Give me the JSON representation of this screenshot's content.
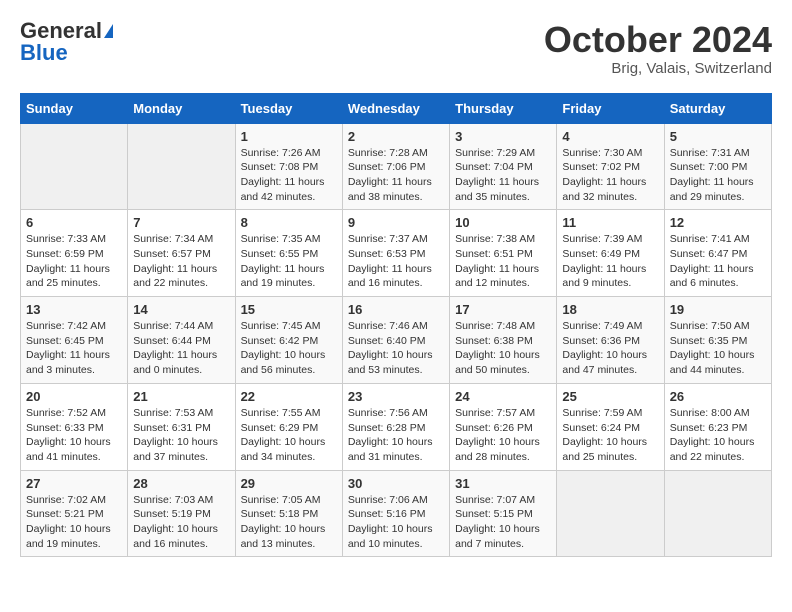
{
  "header": {
    "logo_general": "General",
    "logo_blue": "Blue",
    "month_title": "October 2024",
    "location": "Brig, Valais, Switzerland"
  },
  "days_of_week": [
    "Sunday",
    "Monday",
    "Tuesday",
    "Wednesday",
    "Thursday",
    "Friday",
    "Saturday"
  ],
  "weeks": [
    [
      {
        "num": "",
        "sunrise": "",
        "sunset": "",
        "daylight": "",
        "empty": true
      },
      {
        "num": "",
        "sunrise": "",
        "sunset": "",
        "daylight": "",
        "empty": true
      },
      {
        "num": "1",
        "sunrise": "Sunrise: 7:26 AM",
        "sunset": "Sunset: 7:08 PM",
        "daylight": "Daylight: 11 hours and 42 minutes."
      },
      {
        "num": "2",
        "sunrise": "Sunrise: 7:28 AM",
        "sunset": "Sunset: 7:06 PM",
        "daylight": "Daylight: 11 hours and 38 minutes."
      },
      {
        "num": "3",
        "sunrise": "Sunrise: 7:29 AM",
        "sunset": "Sunset: 7:04 PM",
        "daylight": "Daylight: 11 hours and 35 minutes."
      },
      {
        "num": "4",
        "sunrise": "Sunrise: 7:30 AM",
        "sunset": "Sunset: 7:02 PM",
        "daylight": "Daylight: 11 hours and 32 minutes."
      },
      {
        "num": "5",
        "sunrise": "Sunrise: 7:31 AM",
        "sunset": "Sunset: 7:00 PM",
        "daylight": "Daylight: 11 hours and 29 minutes."
      }
    ],
    [
      {
        "num": "6",
        "sunrise": "Sunrise: 7:33 AM",
        "sunset": "Sunset: 6:59 PM",
        "daylight": "Daylight: 11 hours and 25 minutes."
      },
      {
        "num": "7",
        "sunrise": "Sunrise: 7:34 AM",
        "sunset": "Sunset: 6:57 PM",
        "daylight": "Daylight: 11 hours and 22 minutes."
      },
      {
        "num": "8",
        "sunrise": "Sunrise: 7:35 AM",
        "sunset": "Sunset: 6:55 PM",
        "daylight": "Daylight: 11 hours and 19 minutes."
      },
      {
        "num": "9",
        "sunrise": "Sunrise: 7:37 AM",
        "sunset": "Sunset: 6:53 PM",
        "daylight": "Daylight: 11 hours and 16 minutes."
      },
      {
        "num": "10",
        "sunrise": "Sunrise: 7:38 AM",
        "sunset": "Sunset: 6:51 PM",
        "daylight": "Daylight: 11 hours and 12 minutes."
      },
      {
        "num": "11",
        "sunrise": "Sunrise: 7:39 AM",
        "sunset": "Sunset: 6:49 PM",
        "daylight": "Daylight: 11 hours and 9 minutes."
      },
      {
        "num": "12",
        "sunrise": "Sunrise: 7:41 AM",
        "sunset": "Sunset: 6:47 PM",
        "daylight": "Daylight: 11 hours and 6 minutes."
      }
    ],
    [
      {
        "num": "13",
        "sunrise": "Sunrise: 7:42 AM",
        "sunset": "Sunset: 6:45 PM",
        "daylight": "Daylight: 11 hours and 3 minutes."
      },
      {
        "num": "14",
        "sunrise": "Sunrise: 7:44 AM",
        "sunset": "Sunset: 6:44 PM",
        "daylight": "Daylight: 11 hours and 0 minutes."
      },
      {
        "num": "15",
        "sunrise": "Sunrise: 7:45 AM",
        "sunset": "Sunset: 6:42 PM",
        "daylight": "Daylight: 10 hours and 56 minutes."
      },
      {
        "num": "16",
        "sunrise": "Sunrise: 7:46 AM",
        "sunset": "Sunset: 6:40 PM",
        "daylight": "Daylight: 10 hours and 53 minutes."
      },
      {
        "num": "17",
        "sunrise": "Sunrise: 7:48 AM",
        "sunset": "Sunset: 6:38 PM",
        "daylight": "Daylight: 10 hours and 50 minutes."
      },
      {
        "num": "18",
        "sunrise": "Sunrise: 7:49 AM",
        "sunset": "Sunset: 6:36 PM",
        "daylight": "Daylight: 10 hours and 47 minutes."
      },
      {
        "num": "19",
        "sunrise": "Sunrise: 7:50 AM",
        "sunset": "Sunset: 6:35 PM",
        "daylight": "Daylight: 10 hours and 44 minutes."
      }
    ],
    [
      {
        "num": "20",
        "sunrise": "Sunrise: 7:52 AM",
        "sunset": "Sunset: 6:33 PM",
        "daylight": "Daylight: 10 hours and 41 minutes."
      },
      {
        "num": "21",
        "sunrise": "Sunrise: 7:53 AM",
        "sunset": "Sunset: 6:31 PM",
        "daylight": "Daylight: 10 hours and 37 minutes."
      },
      {
        "num": "22",
        "sunrise": "Sunrise: 7:55 AM",
        "sunset": "Sunset: 6:29 PM",
        "daylight": "Daylight: 10 hours and 34 minutes."
      },
      {
        "num": "23",
        "sunrise": "Sunrise: 7:56 AM",
        "sunset": "Sunset: 6:28 PM",
        "daylight": "Daylight: 10 hours and 31 minutes."
      },
      {
        "num": "24",
        "sunrise": "Sunrise: 7:57 AM",
        "sunset": "Sunset: 6:26 PM",
        "daylight": "Daylight: 10 hours and 28 minutes."
      },
      {
        "num": "25",
        "sunrise": "Sunrise: 7:59 AM",
        "sunset": "Sunset: 6:24 PM",
        "daylight": "Daylight: 10 hours and 25 minutes."
      },
      {
        "num": "26",
        "sunrise": "Sunrise: 8:00 AM",
        "sunset": "Sunset: 6:23 PM",
        "daylight": "Daylight: 10 hours and 22 minutes."
      }
    ],
    [
      {
        "num": "27",
        "sunrise": "Sunrise: 7:02 AM",
        "sunset": "Sunset: 5:21 PM",
        "daylight": "Daylight: 10 hours and 19 minutes."
      },
      {
        "num": "28",
        "sunrise": "Sunrise: 7:03 AM",
        "sunset": "Sunset: 5:19 PM",
        "daylight": "Daylight: 10 hours and 16 minutes."
      },
      {
        "num": "29",
        "sunrise": "Sunrise: 7:05 AM",
        "sunset": "Sunset: 5:18 PM",
        "daylight": "Daylight: 10 hours and 13 minutes."
      },
      {
        "num": "30",
        "sunrise": "Sunrise: 7:06 AM",
        "sunset": "Sunset: 5:16 PM",
        "daylight": "Daylight: 10 hours and 10 minutes."
      },
      {
        "num": "31",
        "sunrise": "Sunrise: 7:07 AM",
        "sunset": "Sunset: 5:15 PM",
        "daylight": "Daylight: 10 hours and 7 minutes."
      },
      {
        "num": "",
        "sunrise": "",
        "sunset": "",
        "daylight": "",
        "empty": true
      },
      {
        "num": "",
        "sunrise": "",
        "sunset": "",
        "daylight": "",
        "empty": true
      }
    ]
  ]
}
